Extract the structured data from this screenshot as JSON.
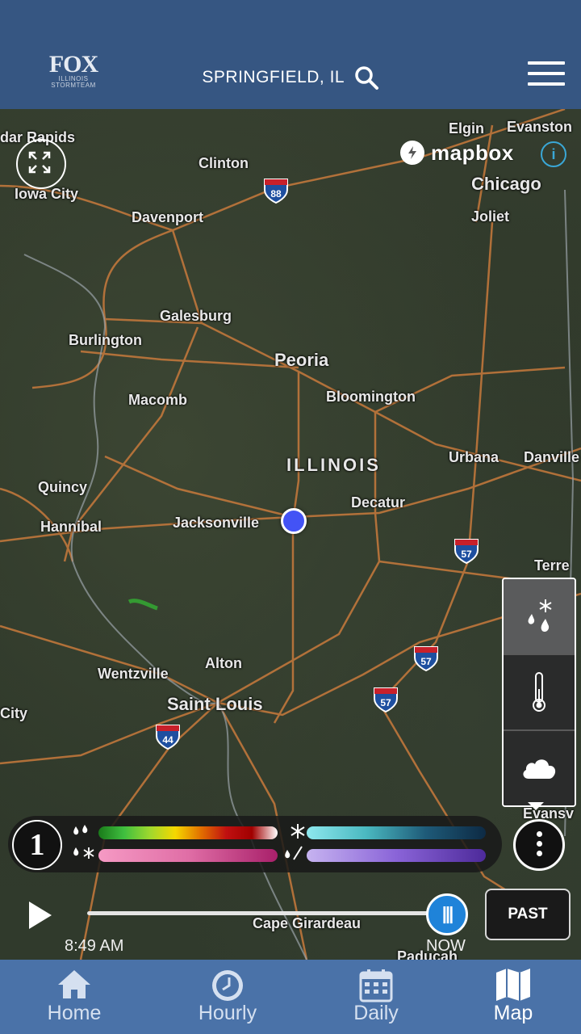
{
  "header": {
    "logo_top": "FOX",
    "logo_mid": "ILLINOIS",
    "logo_bottom": "STORMTEAM",
    "location": "SPRINGFIELD, IL"
  },
  "map": {
    "attribution": "mapbox",
    "state_label": "ILLINOIS",
    "cities": {
      "cedar_rapids": "dar Rapids",
      "clinton": "Clinton",
      "elgin": "Elgin",
      "evanston": "Evanston",
      "iowa_city": "Iowa City",
      "chicago": "Chicago",
      "davenport": "Davenport",
      "joliet": "Joliet",
      "galesburg": "Galesburg",
      "burlington": "Burlington",
      "peoria": "Peoria",
      "macomb": "Macomb",
      "bloomington": "Bloomington",
      "urbana": "Urbana",
      "danville": "Danville",
      "quincy": "Quincy",
      "decatur": "Decatur",
      "hannibal": "Hannibal",
      "jacksonville": "Jacksonville",
      "terre": "Terre",
      "alton": "Alton",
      "wentzville": "Wentzville",
      "saint_louis": "Saint Louis",
      "city": "City",
      "evansv": "Evansv",
      "cape_girardeau": "Cape Girardeau",
      "paducah": "Paducah"
    },
    "shields": {
      "i88": "88",
      "i57a": "57",
      "i57b": "57",
      "i57c": "57",
      "i44": "44"
    }
  },
  "legend": {
    "info_label": "1",
    "rain_gradient": "linear-gradient(90deg,#1a7a1a,#3fbf3f,#9ed82e,#f5d800,#e27000,#c01010,#a00000,#ffffff)",
    "snow_gradient": "linear-gradient(90deg,#8ee8ee,#4ab8c0,#1e5a78,#0d2a44)",
    "mix_gradient": "linear-gradient(90deg,#f59ac4,#e06ea6,#a8206a)",
    "ice_gradient": "linear-gradient(90deg,#c6b3f0,#8a64d8,#4d2a9a)"
  },
  "timeline": {
    "time": "8:49 AM",
    "now_label": "NOW",
    "past_label": "PAST"
  },
  "nav": {
    "home": "Home",
    "hourly": "Hourly",
    "daily": "Daily",
    "map": "Map"
  },
  "colors": {
    "header_bg": "#365682",
    "nav_bg": "#4a72a8",
    "road": "#d8803a",
    "location_dot": "#4353f5",
    "slider_thumb": "#1f83d9"
  }
}
